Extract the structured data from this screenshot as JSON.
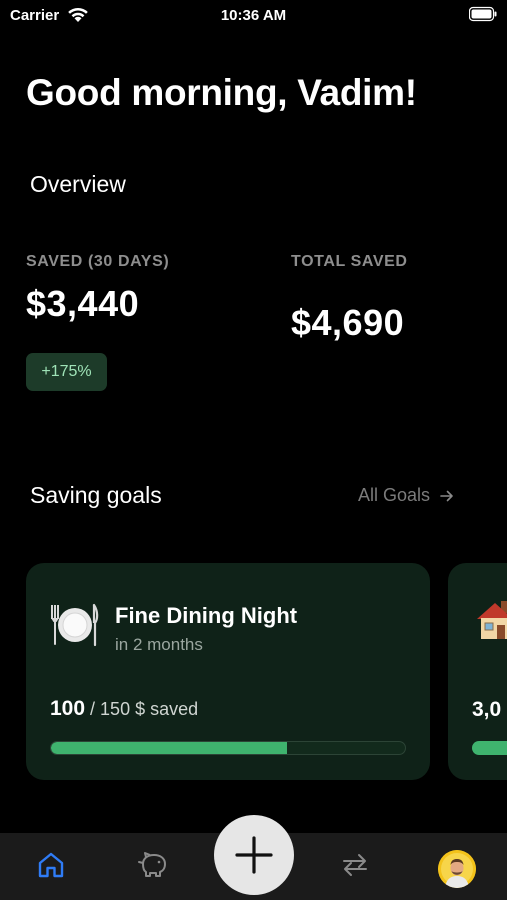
{
  "status_bar": {
    "carrier": "Carrier",
    "time": "10:36 AM"
  },
  "greeting": "Good morning, Vadim!",
  "overview": {
    "title": "Overview",
    "saved_label": "SAVED (30 DAYS)",
    "saved_value": "$3,440",
    "change_badge": "+175%",
    "total_label": "TOTAL SAVED",
    "total_value": "$4,690"
  },
  "goals": {
    "title": "Saving goals",
    "all_goals_link": "All Goals",
    "items": [
      {
        "name": "Fine Dining Night",
        "time_left": "in 2 months",
        "saved_amount": "100",
        "saved_rest": " / 150 $ saved",
        "progress_fraction": 0.667,
        "icon": "plate-icon"
      },
      {
        "saved_amount_partial": "3,0",
        "icon": "house-icon"
      }
    ]
  },
  "tab_bar": {
    "tabs": [
      "home-icon",
      "piggy-bank-icon",
      "add-icon",
      "transfer-icon",
      "avatar"
    ],
    "active": "home-icon",
    "accent": "#2f7cf6"
  },
  "colors": {
    "accent_green": "#3fb36e",
    "card_bg": "#0f2218",
    "badge_bg": "#1d3b29"
  }
}
